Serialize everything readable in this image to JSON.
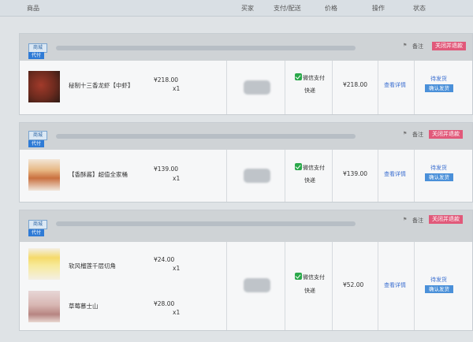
{
  "header": {
    "col_goods": "商品",
    "col_buyer": "买家",
    "col_payment": "支付/配送",
    "col_price": "价格",
    "col_action": "操作",
    "col_status": "状态"
  },
  "orders": [
    {
      "tag_mall": "商城",
      "tag_agent": "代付",
      "note": "备注",
      "close_refund": "关闭并退款",
      "items": [
        {
          "name": "秘制十三香龙虾【中虾】",
          "price": "¥218.00",
          "qty": "x1"
        }
      ],
      "pay_method": "微信支付",
      "delivery": "快递",
      "amount": "¥218.00",
      "view_detail": "查看详情",
      "status": "待发货",
      "confirm": "确认发货"
    },
    {
      "tag_mall": "商城",
      "tag_agent": "代付",
      "note": "备注",
      "close_refund": "关闭并退款",
      "items": [
        {
          "name": "【香酥酱】超值全家桶",
          "price": "¥139.00",
          "qty": "x1"
        }
      ],
      "pay_method": "微信支付",
      "delivery": "快递",
      "amount": "¥139.00",
      "view_detail": "查看详情",
      "status": "待发货",
      "confirm": "确认发货"
    },
    {
      "tag_mall": "商城",
      "tag_agent": "代付",
      "note": "备注",
      "close_refund": "关闭并退款",
      "items": [
        {
          "name": "软风榴莲千层切角",
          "price": "¥24.00",
          "qty": "x1"
        },
        {
          "name": "草莓慕士山",
          "price": "¥28.00",
          "qty": "x1"
        }
      ],
      "pay_method": "微信支付",
      "delivery": "快递",
      "amount": "¥52.00",
      "view_detail": "查看详情",
      "status": "待发货",
      "confirm": "确认发货"
    }
  ]
}
